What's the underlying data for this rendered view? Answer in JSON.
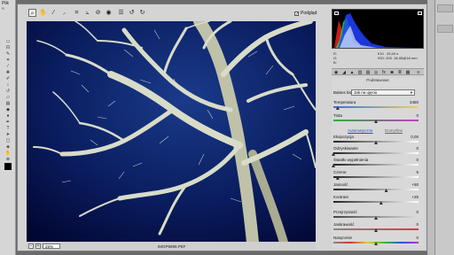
{
  "host": {
    "tab_label": "Plik",
    "collapse_arrows": "«"
  },
  "toolbar": {
    "tools": [
      "zoom-icon",
      "hand-icon",
      "white-balance-icon",
      "color-sampler-icon",
      "crop-icon",
      "straighten-icon",
      "retouch-icon",
      "red-eye-icon",
      "preferences-icon",
      "rotate-left-icon",
      "rotate-right-icon"
    ],
    "preview_label": "Podgląd",
    "preview_checked": true
  },
  "image": {
    "filename": "IMGP5896.PEF",
    "zoom": "25%"
  },
  "histogram": {
    "colors": [
      "#ff2020",
      "#20ff20",
      "#2040ff",
      "#ffffff"
    ]
  },
  "exif": {
    "r_label": "R:",
    "g_label": "G:",
    "b_label": "B:",
    "aperture": "f/10",
    "shutter": "25,00 s",
    "iso": "ISO: 200",
    "lens": "18-55@18 mm"
  },
  "panel": {
    "title": "Podstawowe",
    "white_balance_label": "Balans bieli:",
    "white_balance_value": "Jak na ujęciu",
    "auto_label": "Automatyczne",
    "default_label": "Domyślne",
    "sliders": [
      {
        "label": "Temperatura",
        "value": "2450",
        "level": 0.05,
        "gradient": "linear-gradient(90deg,#3b6fd8,#e8d26a)"
      },
      {
        "label": "Tinta",
        "value": "0",
        "level": 0.5,
        "gradient": "linear-gradient(90deg,#2fae3c,#c040c0)"
      },
      {
        "label": "Ekspozycja",
        "value": "0,00",
        "level": 0.5,
        "gradient": "linear-gradient(90deg,#222,#fff)"
      },
      {
        "label": "Odzyskiwanie",
        "value": "0",
        "level": 0.0,
        "gradient": "linear-gradient(90deg,#222,#fff)"
      },
      {
        "label": "Światło wypełnienia",
        "value": "0",
        "level": 0.0,
        "gradient": "linear-gradient(90deg,#222,#fff)"
      },
      {
        "label": "Czerne",
        "value": "5",
        "level": 0.05,
        "gradient": "linear-gradient(90deg,#222,#fff)"
      },
      {
        "label": "Jasność",
        "value": "+50",
        "level": 0.62,
        "gradient": "linear-gradient(90deg,#222,#fff)"
      },
      {
        "label": "Kontrast",
        "value": "+25",
        "level": 0.56,
        "gradient": "linear-gradient(90deg,#222,#fff)"
      },
      {
        "label": "Przejrzystość",
        "value": "0",
        "level": 0.5,
        "gradient": "linear-gradient(90deg,#444,#ddd)"
      },
      {
        "label": "Jaskrawość",
        "value": "0",
        "level": 0.5,
        "gradient": "linear-gradient(90deg,#888,#d04040)"
      },
      {
        "label": "Nasycenie",
        "value": "0",
        "level": 0.5,
        "gradient": "linear-gradient(90deg,#888,#e03030,#e0d030,#30c030,#3050e0,#c030c0)"
      }
    ]
  }
}
